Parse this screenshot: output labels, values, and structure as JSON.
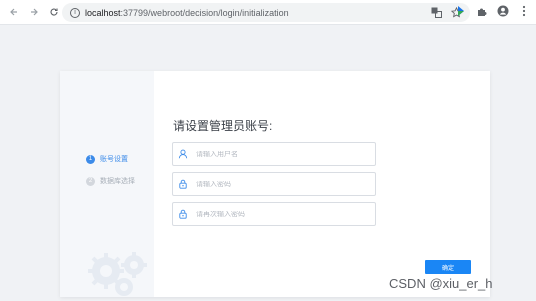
{
  "browser": {
    "url_host": "localhost",
    "url_path": ":37799/webroot/decision/login/initialization",
    "icons": [
      "back-icon",
      "forward-icon",
      "reload-icon",
      "info-icon",
      "translate-icon",
      "star-icon",
      "extension-icon",
      "puzzle-icon",
      "profile-icon",
      "menu-icon"
    ]
  },
  "steps": [
    {
      "number": "1",
      "label": "账号设置",
      "active": true
    },
    {
      "number": "2",
      "label": "数据库选择",
      "active": false
    }
  ],
  "form": {
    "title": "请设置管理员账号:",
    "username_placeholder": "请输入用户名",
    "password_placeholder": "请输入密码",
    "confirm_password_placeholder": "请再次输入密码",
    "confirm_label": "确定"
  },
  "watermark": "CSDN @xiu_er_h",
  "colors": {
    "accent": "#1a86f5",
    "step_active": "#3c8be9",
    "page_bg": "#f0f2f5"
  }
}
